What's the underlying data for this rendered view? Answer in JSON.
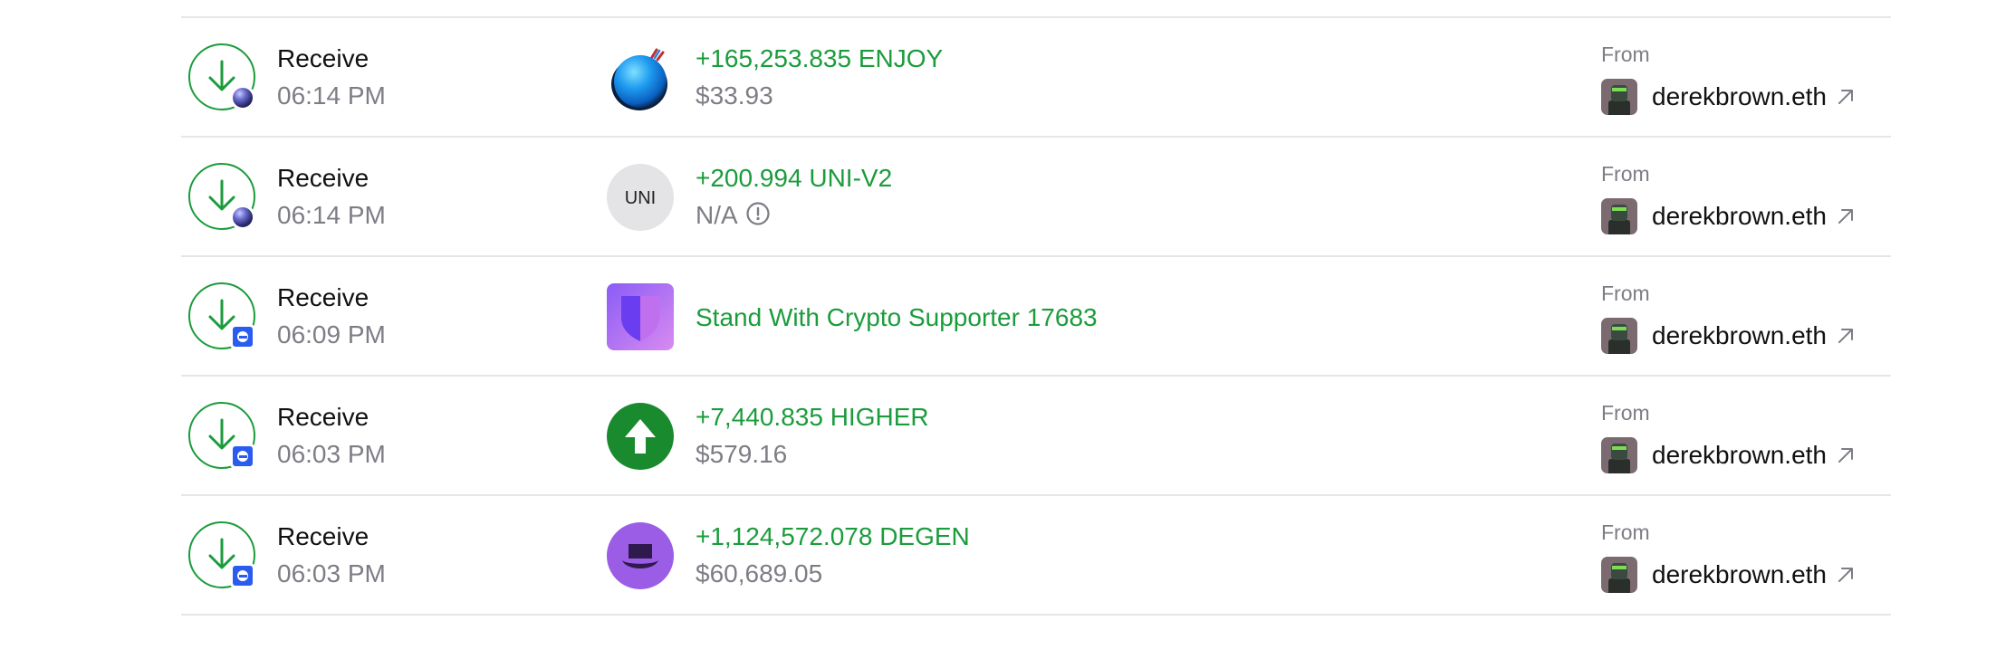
{
  "colors": {
    "positive": "#1b9c3c",
    "muted": "#7d7d85",
    "divider": "#e6e6e8",
    "base_chain": "#2b5cf0"
  },
  "transactions": [
    {
      "action": "Receive",
      "time": "06:14 PM",
      "chain_icon": "ethereum-chain-icon",
      "asset_icon": "enjoy-token-icon",
      "amount": "+165,253.835 ENJOY",
      "value": "$33.93",
      "from_label": "From",
      "from_name": "derekbrown.eth"
    },
    {
      "action": "Receive",
      "time": "06:14 PM",
      "chain_icon": "ethereum-chain-icon",
      "asset_icon": "uni-token-icon",
      "asset_icon_text": "UNI",
      "amount": "+200.994 UNI-V2",
      "value": "N/A",
      "from_label": "From",
      "from_name": "derekbrown.eth"
    },
    {
      "action": "Receive",
      "time": "06:09 PM",
      "chain_icon": "base-chain-icon",
      "asset_icon": "stand-with-crypto-nft-icon",
      "amount": "Stand With Crypto Supporter 17683",
      "value": "",
      "from_label": "From",
      "from_name": "derekbrown.eth"
    },
    {
      "action": "Receive",
      "time": "06:03 PM",
      "chain_icon": "base-chain-icon",
      "asset_icon": "higher-token-icon",
      "amount": "+7,440.835 HIGHER",
      "value": "$579.16",
      "from_label": "From",
      "from_name": "derekbrown.eth"
    },
    {
      "action": "Receive",
      "time": "06:03 PM",
      "chain_icon": "base-chain-icon",
      "asset_icon": "degen-token-icon",
      "amount": "+1,124,572.078 DEGEN",
      "value": "$60,689.05",
      "from_label": "From",
      "from_name": "derekbrown.eth"
    }
  ]
}
